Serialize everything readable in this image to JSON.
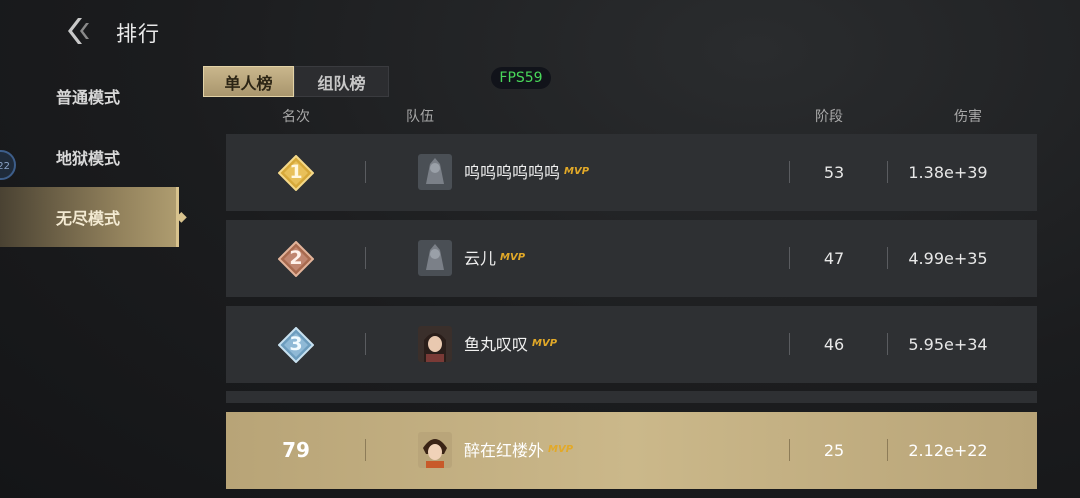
{
  "header": {
    "title": "排行"
  },
  "sidebar": {
    "items": [
      {
        "label": "普通模式",
        "active": false
      },
      {
        "label": "地狱模式",
        "active": false
      },
      {
        "label": "无尽模式",
        "active": true
      }
    ],
    "badge": "22"
  },
  "tabs": [
    {
      "label": "单人榜",
      "active": true
    },
    {
      "label": "组队榜",
      "active": false
    }
  ],
  "fps": "FPS59",
  "columns": {
    "rank": "名次",
    "team": "队伍",
    "stage": "阶段",
    "damage": "伤害"
  },
  "rows": [
    {
      "rank": "1",
      "name": "呜呜呜呜呜呜",
      "mvp": "MVP",
      "stage": "53",
      "damage": "1.38e+39",
      "medal_color": "#d7a93a"
    },
    {
      "rank": "2",
      "name": "云儿",
      "mvp": "MVP",
      "stage": "47",
      "damage": "4.99e+35",
      "medal_color": "#b5785c"
    },
    {
      "rank": "3",
      "name": "鱼丸叹叹",
      "mvp": "MVP",
      "stage": "46",
      "damage": "5.95e+34",
      "medal_color": "#7fb0cf"
    }
  ],
  "my_row": {
    "rank": "79",
    "name": "醉在红楼外",
    "mvp": "MVP",
    "stage": "25",
    "damage": "2.12e+22"
  },
  "colors": {
    "accent": "#c9b68c",
    "fps_text": "#49d85a",
    "mvp": "#e2a928"
  }
}
